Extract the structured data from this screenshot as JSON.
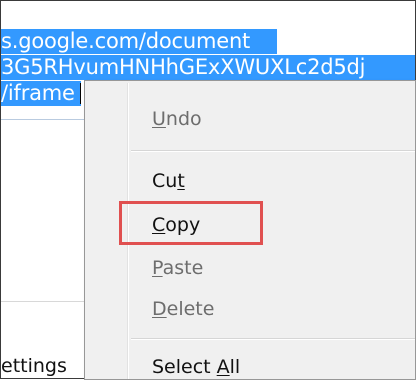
{
  "address": {
    "line1": "s.google.com/document",
    "line2": "3G5RHvumHNHhGExXWUXLc2d5dj",
    "line3": "/iframe"
  },
  "background": {
    "settings_text": "ettings"
  },
  "context_menu": {
    "items": [
      {
        "pre": "",
        "key": "U",
        "post": "ndo",
        "enabled": false
      },
      {
        "pre": "Cu",
        "key": "t",
        "post": "",
        "enabled": true
      },
      {
        "pre": "",
        "key": "C",
        "post": "opy",
        "enabled": true
      },
      {
        "pre": "",
        "key": "P",
        "post": "aste",
        "enabled": false
      },
      {
        "pre": "",
        "key": "D",
        "post": "elete",
        "enabled": false
      },
      {
        "pre": "Select ",
        "key": "A",
        "post": "ll",
        "enabled": true
      }
    ]
  },
  "annotation": {
    "highlighted_item": "Copy",
    "color": "#e05050"
  },
  "colors": {
    "selection": "#3399ff",
    "menu_bg": "#f0f0f0"
  }
}
